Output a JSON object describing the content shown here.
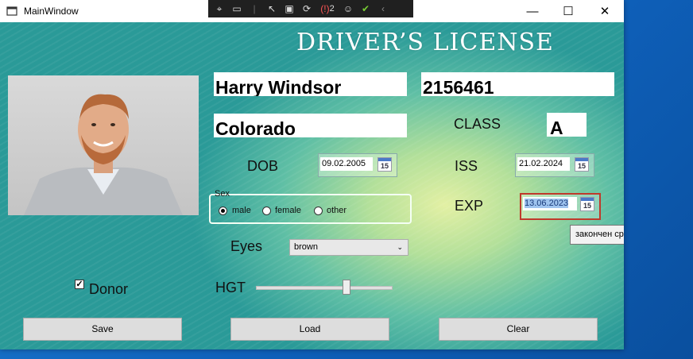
{
  "window": {
    "title": "MainWindow",
    "minimize": "—",
    "maximize": "☐",
    "close": "✕"
  },
  "debug_toolbar": {
    "badge_count": "2"
  },
  "license": {
    "heading": "DRIVER’S LICENSE",
    "name": "Harry Windsor",
    "number": "2156461",
    "state": "Colorado",
    "class_label": "CLASS",
    "class_value": "A",
    "dob_label": "DOB",
    "dob_value": "09.02.2005",
    "iss_label": "ISS",
    "iss_value": "21.02.2024",
    "exp_label": "EXP",
    "exp_value": "13.06.2023",
    "calendar_day": "15",
    "sex": {
      "legend": "Sex",
      "options": [
        "male",
        "female",
        "other"
      ],
      "selected": "male"
    },
    "eyes_label": "Eyes",
    "eyes_value": "brown",
    "donor_label": "Donor",
    "donor_checked": true,
    "hgt_label": "HGT",
    "hgt_value": 0.66
  },
  "buttons": {
    "save": "Save",
    "load": "Load",
    "clear": "Clear"
  },
  "tooltip": "закончен срок действия",
  "colors": {
    "error_border": "#c0392b",
    "accent": "#4a78c8"
  }
}
